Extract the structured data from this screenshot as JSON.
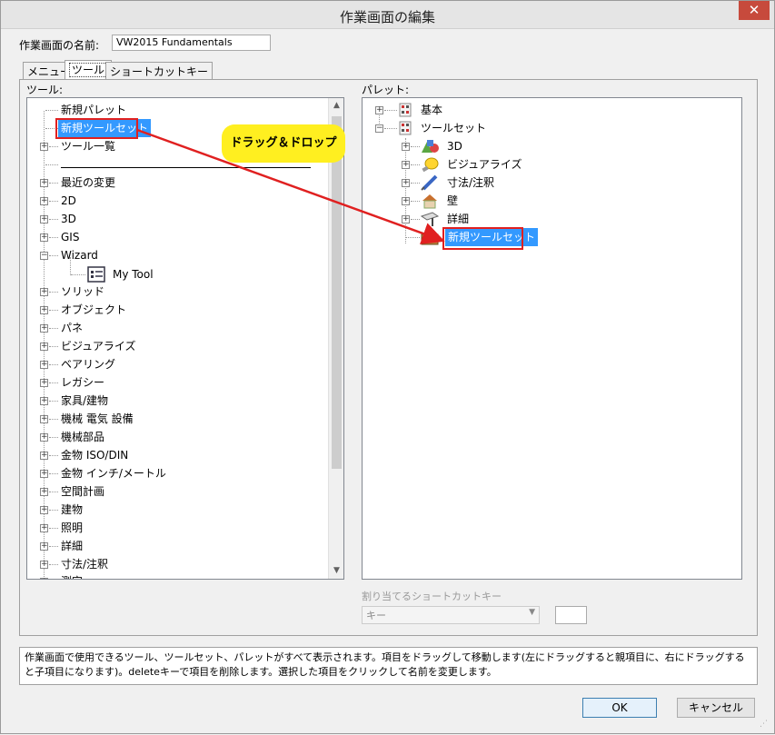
{
  "window": {
    "title": "作業画面の編集",
    "close": "✕"
  },
  "name_label": "作業画面の名前:",
  "name_value": "VW2015 Fundamentals",
  "tabs": [
    "メニュー",
    "ツール",
    "ショートカットキー"
  ],
  "tools_label": "ツール:",
  "palette_label": "パレット:",
  "callout": "ドラッグ＆ドロップ",
  "tools_tree": [
    "新規パレット",
    "新規ツールセット",
    "ツール一覧",
    "",
    "最近の変更",
    "2D",
    "3D",
    "GIS",
    "Wizard",
    "My Tool",
    "ソリッド",
    "オブジェクト",
    "パネ",
    "ビジュアライズ",
    "ベアリング",
    "レガシー",
    "家具/建物",
    "機械 電気 設備",
    "機械部品",
    "金物 ISO/DIN",
    "金物 インチ/メートル",
    "空間計画",
    "建物",
    "照明",
    "詳細",
    "寸法/注釈",
    "測定"
  ],
  "palette_tree": [
    "基本",
    "ツールセット",
    "3D",
    "ビジュアライズ",
    "寸法/注釈",
    "壁",
    "詳細",
    "新規ツールセット"
  ],
  "shortcut_label": "割り当てるショートカットキー",
  "shortcut_combo": "キー",
  "help_text": "作業画面で使用できるツール、ツールセット、パレットがすべて表示されます。項目をドラッグして移動します(左にドラッグすると親項目に、右にドラッグすると子項目になります)。deleteキーで項目を削除します。選択した項目をクリックして名前を変更します。",
  "buttons": {
    "ok": "OK",
    "cancel": "キャンセル"
  },
  "colors": {
    "selection": "#3399ff",
    "highlight": "#e02020",
    "callout": "#ffef20"
  }
}
